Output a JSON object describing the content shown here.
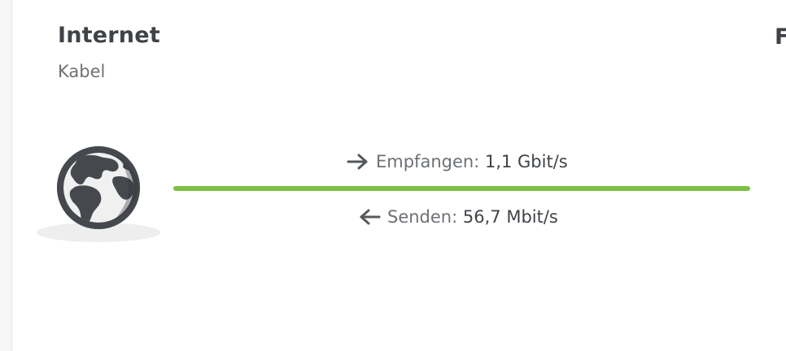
{
  "connection": {
    "title": "Internet",
    "subtitle": "Kabel",
    "next_title_fragment": "F"
  },
  "status": {
    "line_color": "#7cc043",
    "icon": "globe-icon"
  },
  "rates": {
    "download_label": "Empfangen:",
    "download_value": "1,1 Gbit/s",
    "upload_label": "Senden:",
    "upload_value": "56,7 Mbit/s"
  }
}
